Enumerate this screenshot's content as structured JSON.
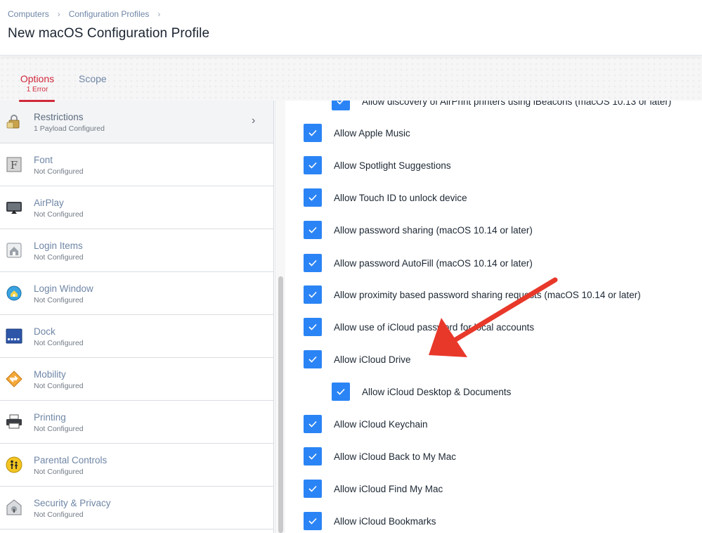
{
  "breadcrumb": [
    "Computers",
    "Configuration Profiles"
  ],
  "page_title": "New macOS Configuration Profile",
  "tabs": {
    "options": {
      "label": "Options",
      "sub": "1 Error"
    },
    "scope": {
      "label": "Scope"
    }
  },
  "sidebar": {
    "items": [
      {
        "name": "Restrictions",
        "status": "1 Payload Configured",
        "icon": "lock-icon"
      },
      {
        "name": "Font",
        "status": "Not Configured",
        "icon": "font-icon"
      },
      {
        "name": "AirPlay",
        "status": "Not Configured",
        "icon": "airplay-icon"
      },
      {
        "name": "Login Items",
        "status": "Not Configured",
        "icon": "login-items-icon"
      },
      {
        "name": "Login Window",
        "status": "Not Configured",
        "icon": "login-window-icon"
      },
      {
        "name": "Dock",
        "status": "Not Configured",
        "icon": "dock-icon"
      },
      {
        "name": "Mobility",
        "status": "Not Configured",
        "icon": "mobility-icon"
      },
      {
        "name": "Printing",
        "status": "Not Configured",
        "icon": "printer-icon"
      },
      {
        "name": "Parental Controls",
        "status": "Not Configured",
        "icon": "parental-controls-icon"
      },
      {
        "name": "Security & Privacy",
        "status": "Not Configured",
        "icon": "security-icon"
      }
    ]
  },
  "options": [
    {
      "label": "Allow discovery of AirPrint printers using iBeacons (macOS 10.13 or later)",
      "checked": true,
      "indent": true
    },
    {
      "label": "Allow Apple Music",
      "checked": true,
      "indent": false
    },
    {
      "label": "Allow Spotlight Suggestions",
      "checked": true,
      "indent": false
    },
    {
      "label": "Allow Touch ID to unlock device",
      "checked": true,
      "indent": false
    },
    {
      "label": "Allow password sharing (macOS 10.14 or later)",
      "checked": true,
      "indent": false
    },
    {
      "label": "Allow password AutoFill (macOS 10.14 or later)",
      "checked": true,
      "indent": false
    },
    {
      "label": "Allow proximity based password sharing requests (macOS 10.14 or later)",
      "checked": true,
      "indent": false
    },
    {
      "label": "Allow use of iCloud password for local accounts",
      "checked": true,
      "indent": false
    },
    {
      "label": "Allow iCloud Drive",
      "checked": true,
      "indent": false
    },
    {
      "label": "Allow iCloud Desktop & Documents",
      "checked": true,
      "indent": true
    },
    {
      "label": "Allow iCloud Keychain",
      "checked": true,
      "indent": false
    },
    {
      "label": "Allow iCloud Back to My Mac",
      "checked": true,
      "indent": false
    },
    {
      "label": "Allow iCloud Find My Mac",
      "checked": true,
      "indent": false
    },
    {
      "label": "Allow iCloud Bookmarks",
      "checked": true,
      "indent": false
    }
  ],
  "colors": {
    "accent_error": "#d0293b",
    "checkbox_blue": "#2b84f5",
    "link_blue": "#6f86a6",
    "annotation_arrow": "#e8382a"
  }
}
